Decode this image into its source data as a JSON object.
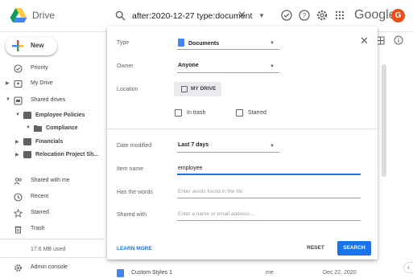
{
  "app": {
    "title": "Drive"
  },
  "search": {
    "query": "after:2020-12-27 type:document"
  },
  "header": {
    "brand_word": "Google",
    "avatar_initial": "G"
  },
  "sidebar": {
    "new_label": "New",
    "items": [
      {
        "label": "Priority",
        "icon": "check-circle-icon"
      },
      {
        "label": "My Drive",
        "icon": "drive-icon"
      },
      {
        "label": "Shared drives",
        "icon": "shared-drives-icon"
      },
      {
        "label": "Employee Policies",
        "icon": "drive-folder-icon"
      },
      {
        "label": "Compliance",
        "icon": "folder-icon"
      },
      {
        "label": "Financials",
        "icon": "drive-folder-icon"
      },
      {
        "label": "Relocation Project Sh...",
        "icon": "drive-folder-icon"
      },
      {
        "label": "Shared with me",
        "icon": "people-icon"
      },
      {
        "label": "Recent",
        "icon": "clock-icon"
      },
      {
        "label": "Starred",
        "icon": "star-icon"
      },
      {
        "label": "Trash",
        "icon": "trash-icon"
      },
      {
        "label": "Admin console",
        "icon": "admin-icon"
      }
    ],
    "storage": "17.6 MB used"
  },
  "panel": {
    "type_label": "Type",
    "type_value": "Documents",
    "owner_label": "Owner",
    "owner_value": "Anyone",
    "location_label": "Location",
    "location_chip": "MY DRIVE",
    "in_trash_label": "In trash",
    "starred_label": "Starred",
    "date_modified_label": "Date modified",
    "date_modified_value": "Last 7 days",
    "item_name_label": "Item name",
    "item_name_value": "employee",
    "has_words_label": "Has the words",
    "has_words_placeholder": "Enter words found in the file",
    "shared_with_label": "Shared with",
    "shared_with_placeholder": "Enter a name or email address...",
    "learn_more": "LEARN MORE",
    "reset": "RESET",
    "search": "SEARCH"
  },
  "file_row": {
    "name": "Custom Styles 1",
    "owner": "me",
    "date": "Dec 22, 2020"
  },
  "colors": {
    "accent": "#1a73e8",
    "avatar": "#e8501a"
  }
}
